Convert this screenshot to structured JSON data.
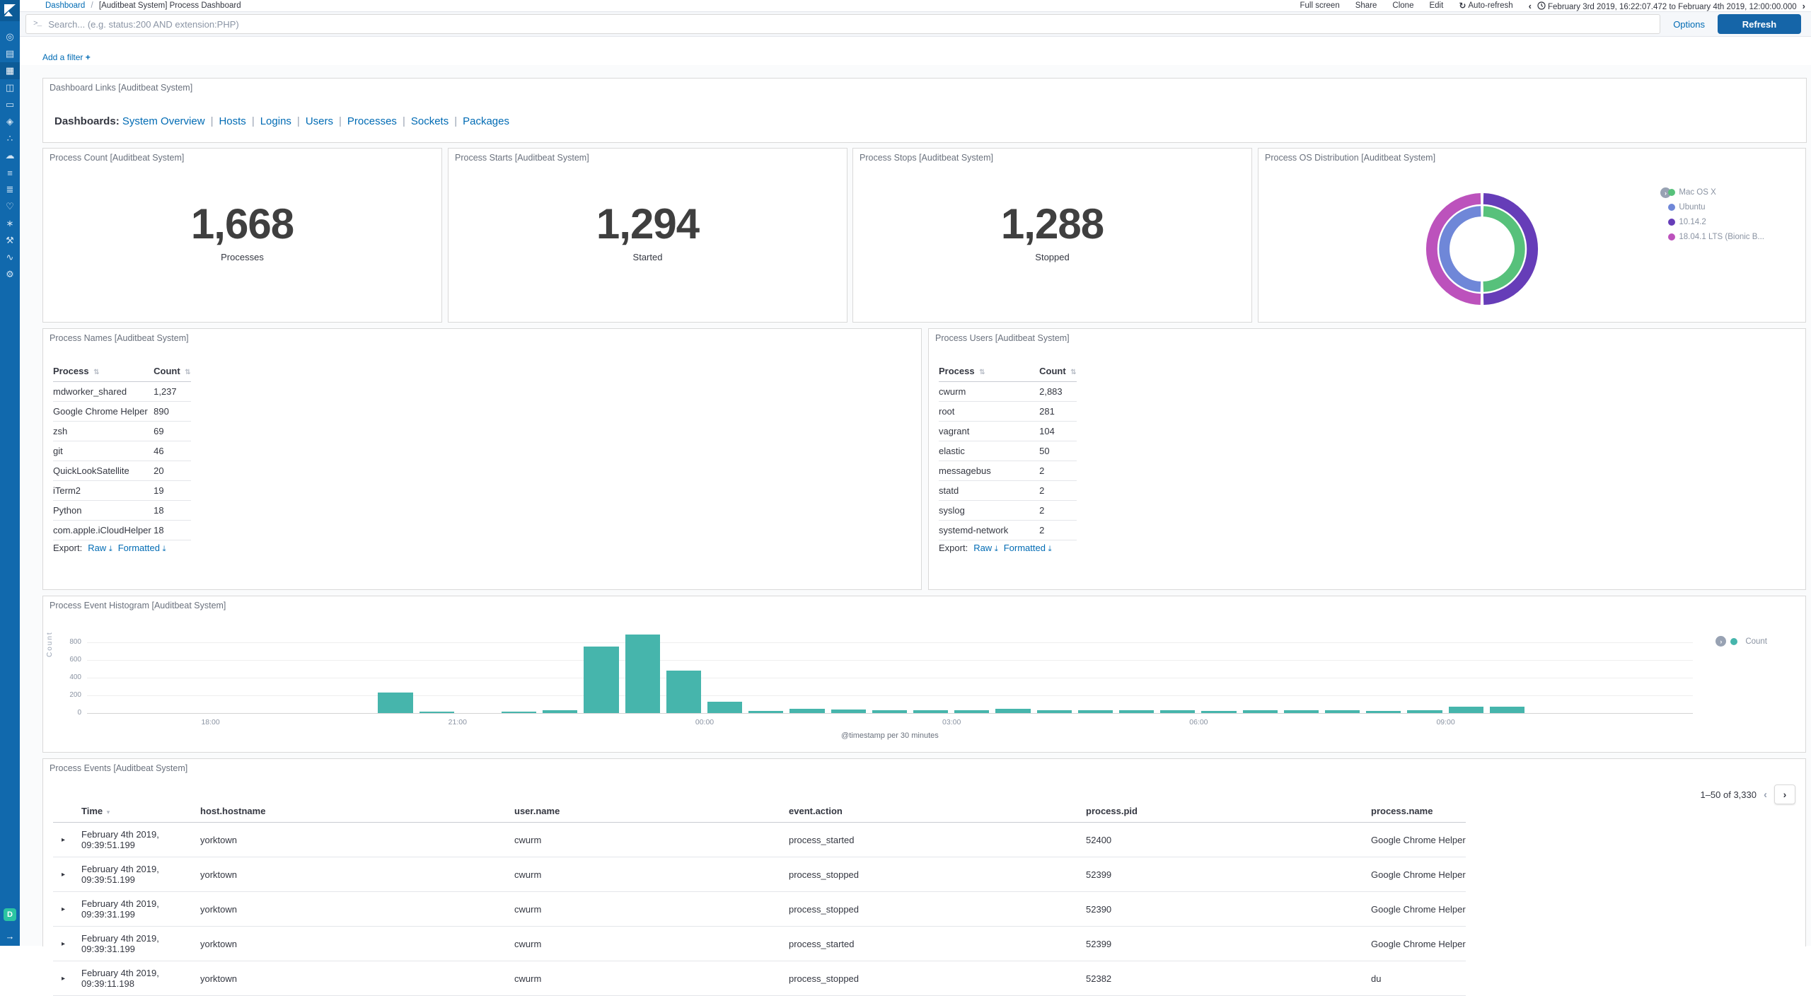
{
  "chrome": {
    "breadcrumb": {
      "root": "Dashboard",
      "separator": "/",
      "current": "[Auditbeat System] Process Dashboard"
    },
    "top_menu": [
      "Full screen",
      "Share",
      "Clone",
      "Edit"
    ],
    "auto_refresh_label": "Auto-refresh",
    "prev_chevron": "‹",
    "next_chevron": "›",
    "time_range": "February 3rd 2019, 16:22:07.472 to February 4th 2019, 12:00:00.000",
    "search_placeholder": "Search... (e.g. status:200 AND extension:PHP)",
    "search_glyph": ">_",
    "options_label": "Options",
    "refresh_label": "Refresh",
    "add_filter_label": "Add a filter",
    "add_filter_plus": "+",
    "refresh_glyph": "↻"
  },
  "sidebar": {
    "items": [
      {
        "name": "discover",
        "glyph": "◎",
        "active": false
      },
      {
        "name": "visualize",
        "glyph": "▤",
        "active": false
      },
      {
        "name": "dashboard",
        "glyph": "▦",
        "active": true
      },
      {
        "name": "timelion",
        "glyph": "◫",
        "active": false
      },
      {
        "name": "canvas",
        "glyph": "▭",
        "active": false
      },
      {
        "name": "maps",
        "glyph": "◈",
        "active": false
      },
      {
        "name": "machine-learning",
        "glyph": "∴",
        "active": false
      },
      {
        "name": "infrastructure",
        "glyph": "☁",
        "active": false
      },
      {
        "name": "logs",
        "glyph": "≡",
        "active": false
      },
      {
        "name": "apm",
        "glyph": "≣",
        "active": false
      },
      {
        "name": "uptime",
        "glyph": "♡",
        "active": false
      },
      {
        "name": "graph",
        "glyph": "∗",
        "active": false
      },
      {
        "name": "dev-tools",
        "glyph": "⚒",
        "active": false
      },
      {
        "name": "monitoring",
        "glyph": "∿",
        "active": false
      },
      {
        "name": "management",
        "glyph": "⚙",
        "active": false
      }
    ],
    "space_badge": "D",
    "collapse_arrow": "→"
  },
  "panels": {
    "links": {
      "title": "Dashboard Links [Auditbeat System]",
      "label": "Dashboards",
      "separator": "|",
      "links": [
        "System Overview",
        "Hosts",
        "Logins",
        "Users",
        "Processes",
        "Sockets",
        "Packages"
      ]
    },
    "metrics": [
      {
        "title": "Process Count [Auditbeat System]",
        "value": "1,668",
        "label": "Processes"
      },
      {
        "title": "Process Starts [Auditbeat System]",
        "value": "1,294",
        "label": "Started"
      },
      {
        "title": "Process Stops [Auditbeat System]",
        "value": "1,288",
        "label": "Stopped"
      }
    ],
    "os_distribution": {
      "title": "Process OS Distribution [Auditbeat System]",
      "legend": [
        {
          "label": "Mac OS X",
          "color": "#57c17b"
        },
        {
          "label": "Ubuntu",
          "color": "#6f87d8"
        },
        {
          "label": "10.14.2",
          "color": "#663db8"
        },
        {
          "label": "18.04.1 LTS (Bionic B...",
          "color": "#bc52bc"
        }
      ]
    },
    "process_names": {
      "title": "Process Names [Auditbeat System]",
      "columns": [
        "Process",
        "Count"
      ],
      "rows": [
        [
          "mdworker_shared",
          "1,237"
        ],
        [
          "Google Chrome Helper",
          "890"
        ],
        [
          "zsh",
          "69"
        ],
        [
          "git",
          "46"
        ],
        [
          "QuickLookSatellite",
          "20"
        ],
        [
          "iTerm2",
          "19"
        ],
        [
          "Python",
          "18"
        ],
        [
          "com.apple.iCloudHelper",
          "18"
        ]
      ],
      "export_label": "Export:",
      "export_links": [
        "Raw",
        "Formatted"
      ]
    },
    "process_users": {
      "title": "Process Users [Auditbeat System]",
      "columns": [
        "Process",
        "Count"
      ],
      "rows": [
        [
          "cwurm",
          "2,883"
        ],
        [
          "root",
          "281"
        ],
        [
          "vagrant",
          "104"
        ],
        [
          "elastic",
          "50"
        ],
        [
          "messagebus",
          "2"
        ],
        [
          "statd",
          "2"
        ],
        [
          "syslog",
          "2"
        ],
        [
          "systemd-network",
          "2"
        ]
      ],
      "export_label": "Export:",
      "export_links": [
        "Raw",
        "Formatted"
      ]
    },
    "histogram": {
      "title": "Process Event Histogram [Auditbeat System]",
      "legend_label": "Count"
    },
    "events": {
      "title": "Process Events [Auditbeat System]",
      "pagination": "1–50 of 3,330",
      "columns": [
        "Time",
        "host.hostname",
        "user.name",
        "event.action",
        "process.pid",
        "process.name"
      ],
      "rows": [
        {
          "time": "February 4th 2019, 09:39:51.199",
          "host": "yorktown",
          "user": "cwurm",
          "action": "process_started",
          "pid": "52400",
          "name": "Google Chrome Helper"
        },
        {
          "time": "February 4th 2019, 09:39:51.199",
          "host": "yorktown",
          "user": "cwurm",
          "action": "process_stopped",
          "pid": "52399",
          "name": "Google Chrome Helper"
        },
        {
          "time": "February 4th 2019, 09:39:31.199",
          "host": "yorktown",
          "user": "cwurm",
          "action": "process_stopped",
          "pid": "52390",
          "name": "Google Chrome Helper"
        },
        {
          "time": "February 4th 2019, 09:39:31.199",
          "host": "yorktown",
          "user": "cwurm",
          "action": "process_started",
          "pid": "52399",
          "name": "Google Chrome Helper"
        },
        {
          "time": "February 4th 2019, 09:39:11.198",
          "host": "yorktown",
          "user": "cwurm",
          "action": "process_stopped",
          "pid": "52382",
          "name": "du"
        }
      ]
    }
  },
  "chart_data": [
    {
      "type": "pie",
      "title": "Process OS Distribution [Auditbeat System]",
      "donut": true,
      "legend_position": "right",
      "rings": [
        {
          "name": "inner-host.os.name",
          "slices": [
            {
              "label": "Mac OS X",
              "value": 50.5,
              "color": "#57c17b"
            },
            {
              "label": "Ubuntu",
              "value": 49.5,
              "color": "#6f87d8"
            }
          ]
        },
        {
          "name": "outer-host.os.version",
          "slices": [
            {
              "label": "10.14.2",
              "value": 50.5,
              "color": "#663db8"
            },
            {
              "label": "18.04.1 LTS (Bionic B...",
              "value": 49.5,
              "color": "#bc52bc"
            }
          ]
        }
      ]
    },
    {
      "type": "bar",
      "title": "Process Event Histogram [Auditbeat System]",
      "xlabel": "@timestamp per 30 minutes",
      "ylabel": "Count",
      "ylim": [
        0,
        900
      ],
      "yticks": [
        0,
        200,
        400,
        600,
        800
      ],
      "xticks": [
        "18:00",
        "21:00",
        "00:00",
        "03:00",
        "06:00",
        "09:00"
      ],
      "legend": [
        "Count"
      ],
      "color": "#46b5ac",
      "grid": true,
      "x_start": "16:30",
      "x_end": "12:00",
      "interval_minutes": 30,
      "bars": [
        [
          "20:00",
          230
        ],
        [
          "20:30",
          12
        ],
        [
          "21:30",
          6
        ],
        [
          "22:00",
          35
        ],
        [
          "22:30",
          755
        ],
        [
          "23:00",
          890
        ],
        [
          "23:30",
          480
        ],
        [
          "00:00",
          125
        ],
        [
          "00:30",
          28
        ],
        [
          "01:00",
          45
        ],
        [
          "01:30",
          40
        ],
        [
          "02:00",
          35
        ],
        [
          "02:30",
          33
        ],
        [
          "03:00",
          30
        ],
        [
          "03:30",
          45
        ],
        [
          "04:00",
          30
        ],
        [
          "04:30",
          35
        ],
        [
          "05:00",
          33
        ],
        [
          "05:30",
          30
        ],
        [
          "06:00",
          25
        ],
        [
          "06:30",
          30
        ],
        [
          "07:00",
          35
        ],
        [
          "07:30",
          35
        ],
        [
          "08:00",
          22
        ],
        [
          "08:30",
          30
        ],
        [
          "09:00",
          70
        ],
        [
          "09:30",
          70
        ]
      ]
    }
  ]
}
